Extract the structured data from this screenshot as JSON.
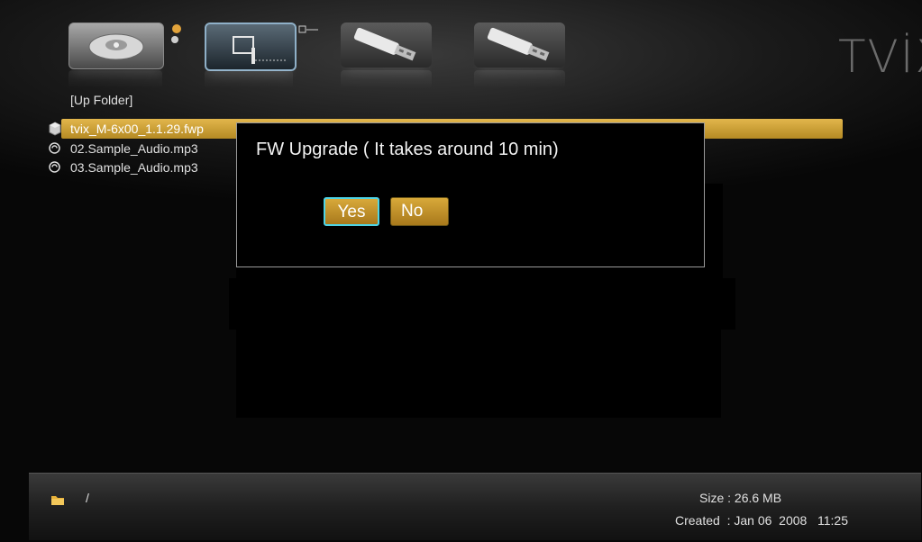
{
  "app": {
    "logo": "TVİX"
  },
  "devices": [
    {
      "name": "hdd"
    },
    {
      "name": "network"
    },
    {
      "name": "usb-1"
    },
    {
      "name": "usb-2"
    }
  ],
  "file_list": {
    "up_folder": "[Up Folder]",
    "items": [
      {
        "name": "tvix_M-6x00_1.1.29.fwp",
        "icon": "firmware-cube-icon",
        "selected": true
      },
      {
        "name": "02.Sample_Audio.mp3",
        "icon": "audio-disc-icon",
        "selected": false
      },
      {
        "name": "03.Sample_Audio.mp3",
        "icon": "audio-disc-icon",
        "selected": false
      }
    ]
  },
  "dialog": {
    "title": "FW Upgrade ( It takes around 10 min)",
    "yes_label": "Yes",
    "no_label": "No",
    "focused": "Yes"
  },
  "status_bar": {
    "path": "/",
    "size": "Size : 26.6 MB",
    "created": "Created  : Jan 06  2008   11:25"
  },
  "colors": {
    "selection": "#d3a53a",
    "focus_ring": "#4ed4e6",
    "background": "#000000"
  }
}
